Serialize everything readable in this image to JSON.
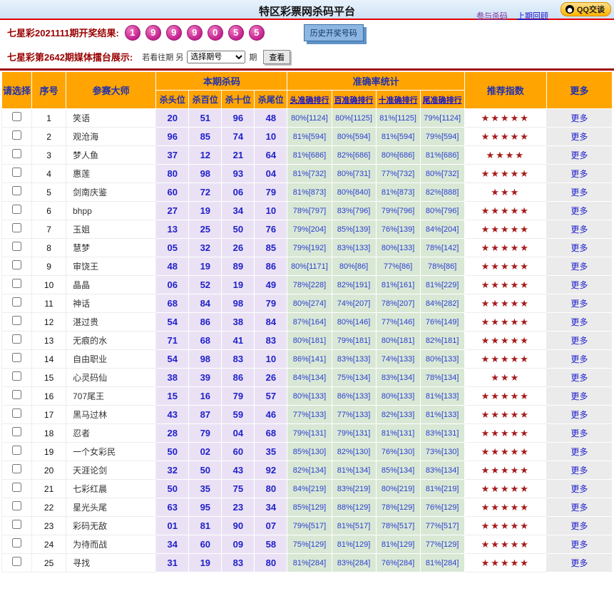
{
  "header": {
    "title": "特区彩票网杀码平台",
    "links": {
      "join": "参与杀码",
      "previous": "上期回顾"
    },
    "qq_button": "QQ交谈"
  },
  "result_bar": {
    "label": "七星彩2021111期开奖结果:",
    "balls": [
      "1",
      "9",
      "9",
      "9",
      "0",
      "5",
      "5"
    ],
    "history_button": "历史开奖号码",
    "ball_color": "#c4218f"
  },
  "control_bar": {
    "label": "七星彩第2642期媒体擂台展示:",
    "hint": "若看往期 另",
    "select_value": "选择期号",
    "period_suffix": "期",
    "view_button": "查看"
  },
  "table": {
    "headers": {
      "select": "请选择",
      "index": "序号",
      "master": "参赛大师",
      "kill_group": "本期杀码",
      "kill_cols": [
        "杀头位",
        "杀百位",
        "杀十位",
        "杀尾位"
      ],
      "acc_group": "准确率统计",
      "acc_cols": [
        "头准确排行",
        "百准确排行",
        "十准确排行",
        "尾准确排行"
      ],
      "stars": "推荐指数",
      "more": "更多"
    },
    "more_label": "更多",
    "star_color": "#a61c1c",
    "header_color": "#ffa400",
    "rows": [
      {
        "no": "1",
        "name": "笑语",
        "kills": [
          "20",
          "51",
          "96",
          "48"
        ],
        "acc": [
          "80%[1124]",
          "80%[1125]",
          "81%[1125]",
          "79%[1124]"
        ],
        "stars": 5
      },
      {
        "no": "2",
        "name": "观沧海",
        "kills": [
          "96",
          "85",
          "74",
          "10"
        ],
        "acc": [
          "81%[594]",
          "80%[594]",
          "81%[594]",
          "79%[594]"
        ],
        "stars": 5
      },
      {
        "no": "3",
        "name": "梦人鱼",
        "kills": [
          "37",
          "12",
          "21",
          "64"
        ],
        "acc": [
          "81%[686]",
          "82%[686]",
          "80%[686]",
          "81%[686]"
        ],
        "stars": 4
      },
      {
        "no": "4",
        "name": "惠莲",
        "kills": [
          "80",
          "98",
          "93",
          "04"
        ],
        "acc": [
          "81%[732]",
          "80%[731]",
          "77%[732]",
          "80%[732]"
        ],
        "stars": 5
      },
      {
        "no": "5",
        "name": "剑南庆鉴",
        "kills": [
          "60",
          "72",
          "06",
          "79"
        ],
        "acc": [
          "81%[873]",
          "80%[840]",
          "81%[873]",
          "82%[888]"
        ],
        "stars": 3
      },
      {
        "no": "6",
        "name": "bhpp",
        "kills": [
          "27",
          "19",
          "34",
          "10"
        ],
        "acc": [
          "78%[797]",
          "83%[796]",
          "79%[796]",
          "80%[796]"
        ],
        "stars": 5
      },
      {
        "no": "7",
        "name": "玉姐",
        "kills": [
          "13",
          "25",
          "50",
          "76"
        ],
        "acc": [
          "79%[204]",
          "85%[139]",
          "76%[139]",
          "84%[204]"
        ],
        "stars": 5
      },
      {
        "no": "8",
        "name": "慧梦",
        "kills": [
          "05",
          "32",
          "26",
          "85"
        ],
        "acc": [
          "79%[192]",
          "83%[133]",
          "80%[133]",
          "78%[142]"
        ],
        "stars": 5
      },
      {
        "no": "9",
        "name": "审饶王",
        "kills": [
          "48",
          "19",
          "89",
          "86"
        ],
        "acc": [
          "80%[1171]",
          "80%[86]",
          "77%[86]",
          "78%[86]"
        ],
        "stars": 5
      },
      {
        "no": "10",
        "name": "晶晶",
        "kills": [
          "06",
          "52",
          "19",
          "49"
        ],
        "acc": [
          "78%[228]",
          "82%[191]",
          "81%[161]",
          "81%[229]"
        ],
        "stars": 5
      },
      {
        "no": "11",
        "name": "神话",
        "kills": [
          "68",
          "84",
          "98",
          "79"
        ],
        "acc": [
          "80%[274]",
          "74%[207]",
          "78%[207]",
          "84%[282]"
        ],
        "stars": 5
      },
      {
        "no": "12",
        "name": "湛过贵",
        "kills": [
          "54",
          "86",
          "38",
          "84"
        ],
        "acc": [
          "87%[164]",
          "80%[146]",
          "77%[146]",
          "76%[149]"
        ],
        "stars": 5
      },
      {
        "no": "13",
        "name": "无痕的水",
        "kills": [
          "71",
          "68",
          "41",
          "83"
        ],
        "acc": [
          "80%[181]",
          "79%[181]",
          "80%[181]",
          "82%[181]"
        ],
        "stars": 5
      },
      {
        "no": "14",
        "name": "自由职业",
        "kills": [
          "54",
          "98",
          "83",
          "10"
        ],
        "acc": [
          "86%[141]",
          "83%[133]",
          "74%[133]",
          "80%[133]"
        ],
        "stars": 5
      },
      {
        "no": "15",
        "name": "心灵码仙",
        "kills": [
          "38",
          "39",
          "86",
          "26"
        ],
        "acc": [
          "84%[134]",
          "75%[134]",
          "83%[134]",
          "78%[134]"
        ],
        "stars": 3
      },
      {
        "no": "16",
        "name": "707尾王",
        "kills": [
          "15",
          "16",
          "79",
          "57"
        ],
        "acc": [
          "80%[133]",
          "86%[133]",
          "80%[133]",
          "81%[133]"
        ],
        "stars": 5
      },
      {
        "no": "17",
        "name": "黑马过林",
        "kills": [
          "43",
          "87",
          "59",
          "46"
        ],
        "acc": [
          "77%[133]",
          "77%[133]",
          "82%[133]",
          "81%[133]"
        ],
        "stars": 5
      },
      {
        "no": "18",
        "name": "忍者",
        "kills": [
          "28",
          "79",
          "04",
          "68"
        ],
        "acc": [
          "79%[131]",
          "79%[131]",
          "81%[131]",
          "83%[131]"
        ],
        "stars": 5
      },
      {
        "no": "19",
        "name": "一个女彩民",
        "kills": [
          "50",
          "02",
          "60",
          "35"
        ],
        "acc": [
          "85%[130]",
          "82%[130]",
          "76%[130]",
          "73%[130]"
        ],
        "stars": 5
      },
      {
        "no": "20",
        "name": "天涯论剑",
        "kills": [
          "32",
          "50",
          "43",
          "92"
        ],
        "acc": [
          "82%[134]",
          "81%[134]",
          "85%[134]",
          "83%[134]"
        ],
        "stars": 5
      },
      {
        "no": "21",
        "name": "七彩红晨",
        "kills": [
          "50",
          "35",
          "75",
          "80"
        ],
        "acc": [
          "84%[219]",
          "83%[219]",
          "80%[219]",
          "81%[219]"
        ],
        "stars": 5
      },
      {
        "no": "22",
        "name": "星光头尾",
        "kills": [
          "63",
          "95",
          "23",
          "34"
        ],
        "acc": [
          "85%[129]",
          "88%[129]",
          "78%[129]",
          "76%[129]"
        ],
        "stars": 5
      },
      {
        "no": "23",
        "name": "彩码无敌",
        "kills": [
          "01",
          "81",
          "90",
          "07"
        ],
        "acc": [
          "79%[517]",
          "81%[517]",
          "78%[517]",
          "77%[517]"
        ],
        "stars": 5
      },
      {
        "no": "24",
        "name": "为待而战",
        "kills": [
          "34",
          "60",
          "09",
          "58"
        ],
        "acc": [
          "75%[129]",
          "81%[129]",
          "81%[129]",
          "77%[129]"
        ],
        "stars": 5
      },
      {
        "no": "25",
        "name": "寻找",
        "kills": [
          "31",
          "19",
          "83",
          "80"
        ],
        "acc": [
          "81%[284]",
          "83%[284]",
          "76%[284]",
          "81%[284]"
        ],
        "stars": 5
      }
    ]
  }
}
